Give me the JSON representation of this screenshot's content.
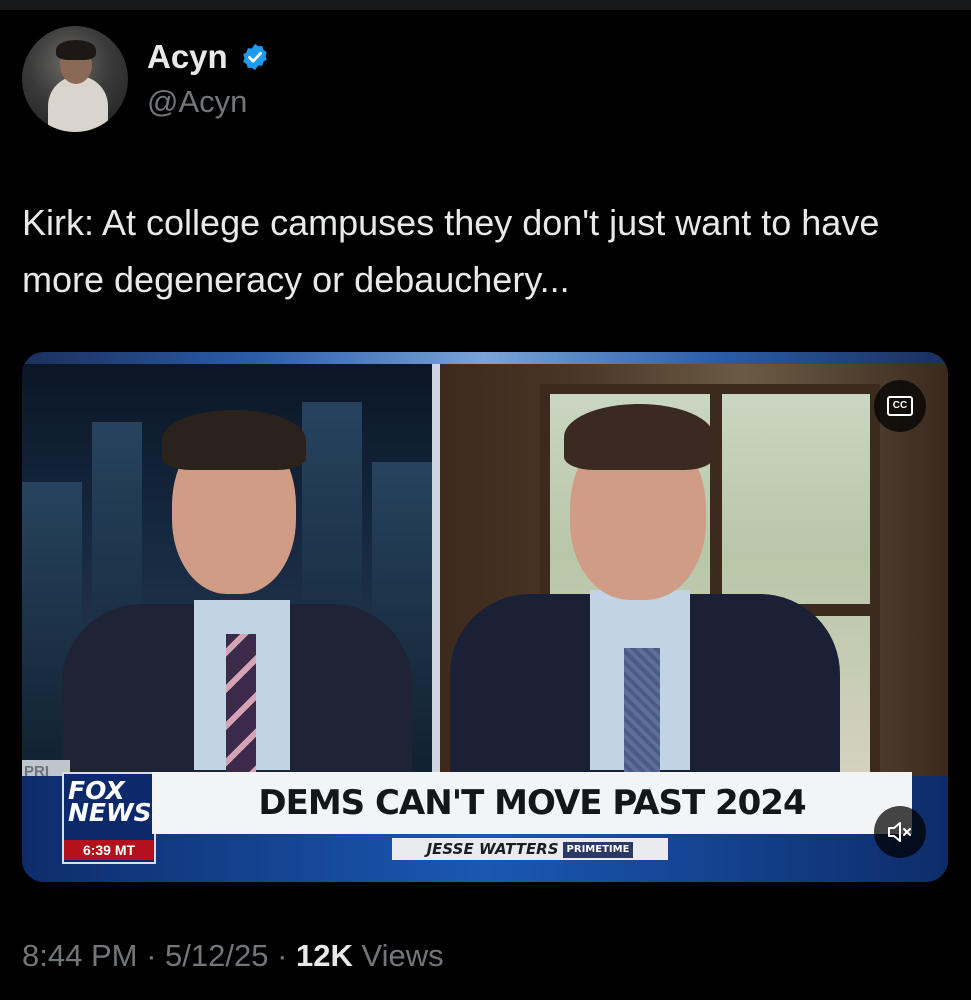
{
  "author": {
    "name": "Acyn",
    "handle": "@Acyn",
    "verified": true
  },
  "tweet": {
    "text": "Kirk: At college campuses they don't just want to have more degeneracy or debauchery..."
  },
  "video": {
    "network_logo_line1": "FOX",
    "network_logo_line2": "NEWS",
    "time": "6:39 MT",
    "side_tag": "PRI",
    "headline": "DEMS CAN'T MOVE PAST 2024",
    "show_name": "JESSE WATTERS",
    "show_tag": "PRIMETIME",
    "cc_label": "CC",
    "cc_icon": "closed-captions-icon",
    "mute_icon": "muted-speaker-icon"
  },
  "meta": {
    "time": "8:44 PM",
    "sep1": " · ",
    "date": "5/12/25",
    "sep2": " · ",
    "views_count": "12K",
    "views_label": " Views"
  },
  "colors": {
    "background": "#000000",
    "text_primary": "#e7e9ea",
    "text_secondary": "#71767b",
    "verified_blue": "#1d9bf0"
  }
}
